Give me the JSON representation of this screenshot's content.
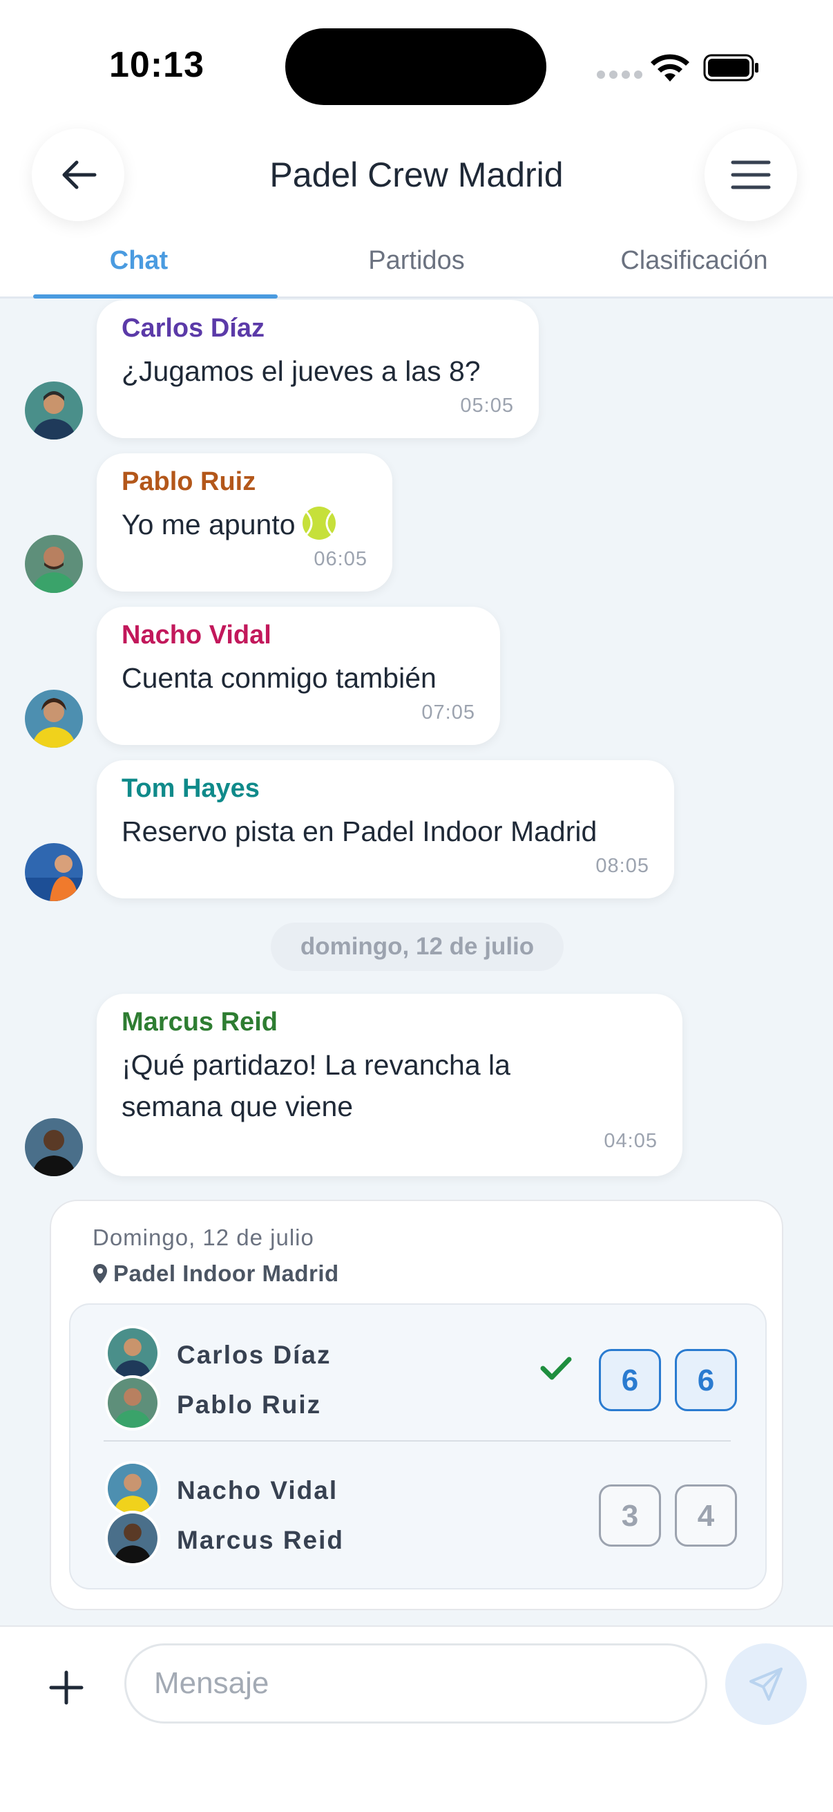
{
  "status_bar": {
    "time": "10:13"
  },
  "header": {
    "title": "Padel Crew Madrid"
  },
  "tabs": [
    {
      "label": "Chat",
      "active": true
    },
    {
      "label": "Partidos",
      "active": false
    },
    {
      "label": "Clasificación",
      "active": false
    }
  ],
  "messages": [
    {
      "sender": "Carlos Díaz",
      "color": "#5b3aa8",
      "text": "¿Jugamos el jueves a las 8?",
      "time": "05:05"
    },
    {
      "sender": "Pablo Ruiz",
      "color": "#b3571a",
      "text": "Yo me apunto",
      "emoji_icon": "tennis-ball-icon",
      "time": "06:05"
    },
    {
      "sender": "Nacho Vidal",
      "color": "#c2185b",
      "text": "Cuenta conmigo también",
      "time": "07:05"
    },
    {
      "sender": "Tom Hayes",
      "color": "#0f8a8a",
      "text": "Reservo pista en Padel Indoor Madrid",
      "time": "08:05"
    },
    {
      "sender": "Marcus Reid",
      "color": "#2e7d32",
      "text_line1": "¡Qué partidazo! La revancha la",
      "text_line2": "semana que viene",
      "time": "04:05"
    }
  ],
  "date_separator": "domingo, 12 de julio",
  "match": {
    "date": "Domingo, 12 de julio",
    "venue": "Padel Indoor Madrid",
    "team1": {
      "player1": "Carlos Díaz",
      "player2": "Pablo Ruiz",
      "winner": true,
      "sets": [
        "6",
        "6"
      ]
    },
    "team2": {
      "player1": "Nacho Vidal",
      "player2": "Marcus Reid",
      "winner": false,
      "sets": [
        "3",
        "4"
      ]
    }
  },
  "composer": {
    "placeholder": "Mensaje"
  },
  "colors": {
    "accent": "#4a9be0",
    "score_win": "#2a7bd0",
    "check": "#1e8e3e"
  }
}
